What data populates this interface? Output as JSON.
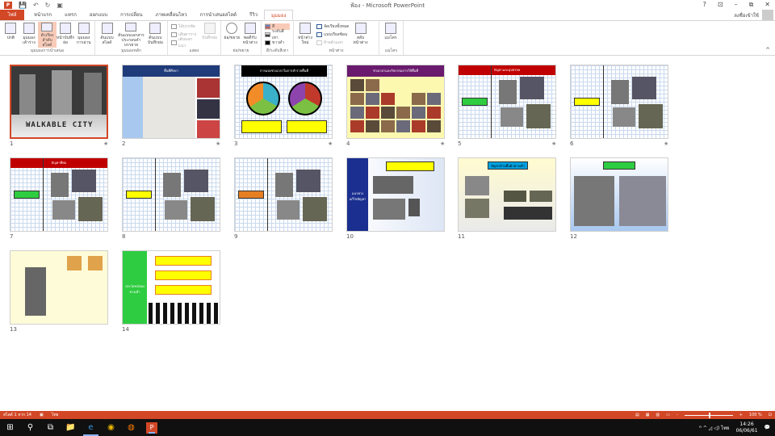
{
  "window": {
    "title": "ฟ้อง - Microsoft PowerPoint",
    "help": "?",
    "ribbon_display": "⊡",
    "minimize": "–",
    "restore": "⧉",
    "close": "✕",
    "sign_in": "ลงชื่อเข้าใช้"
  },
  "qat": {
    "save": "💾",
    "undo": "↶",
    "redo": "↻",
    "start": "▣"
  },
  "tabs": [
    "ไฟล์",
    "หน้าแรก",
    "แทรก",
    "ออกแบบ",
    "การเปลี่ยน",
    "ภาพเคลื่อนไหว",
    "การนำเสนอสไลด์",
    "รีวิว",
    "มุมมอง"
  ],
  "ribbon": {
    "presentation_views": {
      "label": "มุมมองการนำเสนอ",
      "buttons": [
        "ปกติ",
        "มุมมองเค้าร่าง",
        "ตัวเรียงลำดับสไลด์",
        "หน้าบันทึกย่อ",
        "มุมมองการอ่าน"
      ]
    },
    "master_views": {
      "label": "มุมมองหลัก",
      "buttons": [
        "ต้นแบบสไลด์",
        "ต้นแบบเอกสารประกอบคำบรรยาย",
        "ต้นแบบบันทึกย่อ"
      ]
    },
    "show": {
      "label": "แสดง",
      "checks": [
        "ไม้บรรทัด",
        "เส้นตาราง",
        "เส้นบอกแนว"
      ],
      "notes": "บันทึกย่อ"
    },
    "zoom": {
      "label": "ย่อ/ขยาย",
      "buttons": [
        "ย่อ/ขยาย",
        "พอดีกับหน้าต่าง"
      ]
    },
    "color": {
      "label": "สี/ระดับสีเทา",
      "items": [
        "สี",
        "ระดับสีเทา",
        "ขาวดำ"
      ]
    },
    "window": {
      "label": "หน้าต่าง",
      "new": "หน้าต่างใหม่",
      "items": [
        "จัดเรียงทั้งหมด",
        "แบบเรียงซ้อน",
        "ย้ายตัวแยก"
      ],
      "switch": "สลับหน้าต่าง"
    },
    "macros": {
      "label": "แมโคร",
      "button": "แมโคร"
    }
  },
  "slides": [
    {
      "n": "1",
      "title": "WALKABLE CITY",
      "color": "#222222",
      "kind": "cover",
      "star": "★"
    },
    {
      "n": "2",
      "title": "พื้นที่ศึกษา",
      "color": "#1f3b7a",
      "kind": "map",
      "star": "★"
    },
    {
      "n": "3",
      "title": "การแบ่งช่วงเวลาในการสำรวจพื้นที่",
      "color": "#000000",
      "kind": "clock",
      "star": "★"
    },
    {
      "n": "4",
      "title": "ช่วงเวลาและกิจกรรมการใช้พื้นที่",
      "color": "#6a1b6e",
      "kind": "photos-yellow",
      "star": "★"
    },
    {
      "n": "5",
      "title": "ปัญหาและอุปสรรค",
      "color": "#c00000",
      "kind": "grid-photos",
      "star": "★"
    },
    {
      "n": "6",
      "title": "",
      "color": "",
      "kind": "grid-photos",
      "star": "★"
    },
    {
      "n": "7",
      "title": "ปัญหาที่พบ",
      "color": "#c00000",
      "kind": "grid-photos",
      "star": ""
    },
    {
      "n": "8",
      "title": "",
      "color": "",
      "kind": "grid-photos",
      "star": ""
    },
    {
      "n": "9",
      "title": "",
      "color": "",
      "kind": "grid-photos",
      "star": ""
    },
    {
      "n": "10",
      "title": "แนวทางแก้ไขปัญหา",
      "color": "#1a2f8f",
      "kind": "side-blue",
      "star": ""
    },
    {
      "n": "11",
      "title": "ปัญหาด้านพื้นผิวทางเท้า",
      "color": "#00a0e0",
      "kind": "gradient",
      "star": ""
    },
    {
      "n": "12",
      "title": "",
      "color": "#2ecc40",
      "kind": "gradient-blue",
      "star": ""
    },
    {
      "n": "13",
      "title": "",
      "color": "",
      "kind": "yellow-light",
      "star": ""
    },
    {
      "n": "14",
      "title": "ประโยชน์ของทางเท้า",
      "color": "#2ecc40",
      "kind": "side-green",
      "star": ""
    }
  ],
  "status": {
    "slide_info": "สไลด์ 1 จาก 14",
    "language": "ไทย",
    "zoom": "100 %",
    "zoom_minus": "-",
    "zoom_plus": "+"
  },
  "taskbar": {
    "start": "⊞",
    "search": "⚲",
    "taskview": "⧉",
    "explorer": "📁",
    "edge": "e",
    "chrome": "◉",
    "firefox": "◍",
    "powerpoint": "P",
    "tray": "ᴿ ^ ◿ ◁) ไทย",
    "time": "14:26",
    "date": "06/06/61",
    "notify": "💬"
  }
}
